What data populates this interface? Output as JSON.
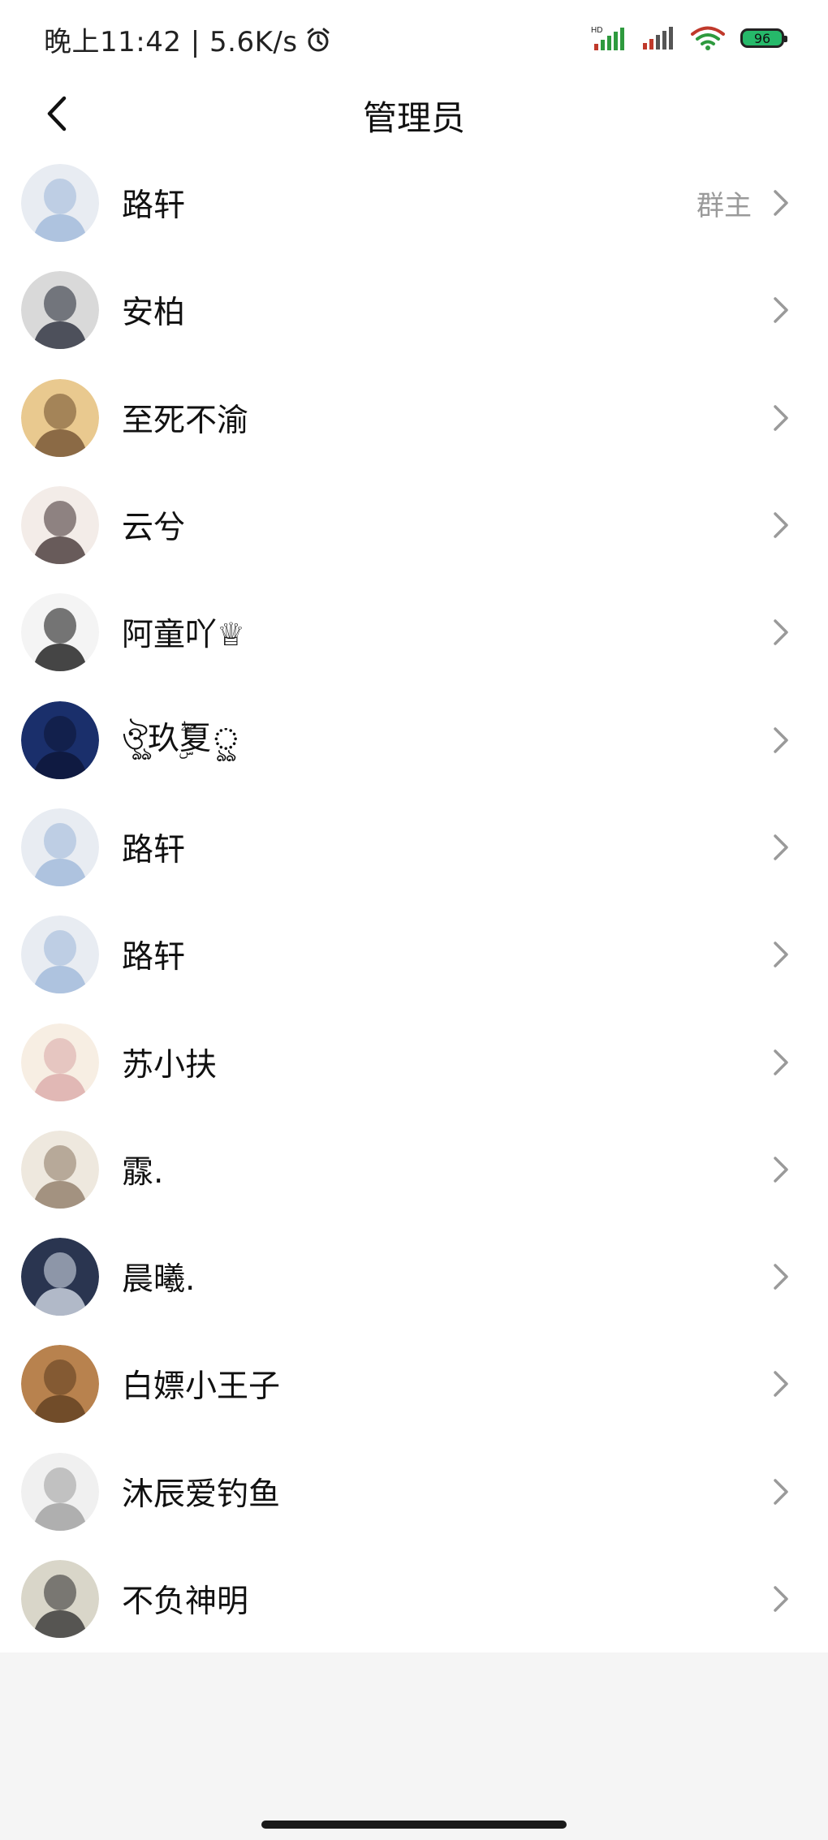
{
  "status_bar": {
    "time": "晚上11:42 | 5.6K/s",
    "alarm_icon": "alarm-clock-icon",
    "battery_level": "96"
  },
  "header": {
    "title": "管理员",
    "back_icon": "chevron-left-icon"
  },
  "members": [
    {
      "name": "路轩",
      "role": "群主",
      "avatar_color": "#e8ecf2",
      "avatar_accent": "#9bb6d8"
    },
    {
      "name": "安柏",
      "role": "",
      "avatar_color": "#d9d9d9",
      "avatar_accent": "#1e2230"
    },
    {
      "name": "至死不渝",
      "role": "",
      "avatar_color": "#e9c98f",
      "avatar_accent": "#6b4a2c"
    },
    {
      "name": "云兮",
      "role": "",
      "avatar_color": "#f3ece8",
      "avatar_accent": "#3a2b2b"
    },
    {
      "name": "阿童吖♕",
      "role": "",
      "avatar_color": "#f4f4f4",
      "avatar_accent": "#0b0b0b"
    },
    {
      "name": "ঔৣ玖ۣۖ夏ৣ",
      "role": "",
      "avatar_color": "#1a2f6b",
      "avatar_accent": "#0c1433"
    },
    {
      "name": "路轩",
      "role": "",
      "avatar_color": "#e8ecf2",
      "avatar_accent": "#9bb6d8"
    },
    {
      "name": "路轩",
      "role": "",
      "avatar_color": "#e8ecf2",
      "avatar_accent": "#9bb6d8"
    },
    {
      "name": "苏小扶",
      "role": "",
      "avatar_color": "#f7eee3",
      "avatar_accent": "#d9a6a6"
    },
    {
      "name": "霡.",
      "role": "",
      "avatar_color": "#eee8de",
      "avatar_accent": "#8a7560"
    },
    {
      "name": "晨曦.",
      "role": "",
      "avatar_color": "#2a3550",
      "avatar_accent": "#dfe6f0"
    },
    {
      "name": "白嫖小王子",
      "role": "",
      "avatar_color": "#b8824e",
      "avatar_accent": "#5a3a1e"
    },
    {
      "name": "沐辰爱钓鱼",
      "role": "",
      "avatar_color": "#f0f0f0",
      "avatar_accent": "#9a9a9a"
    },
    {
      "name": "不负神明",
      "role": "",
      "avatar_color": "#d9d6c9",
      "avatar_accent": "#2a2a2a"
    }
  ],
  "colors": {
    "background": "#f5f5f5",
    "list_background": "#ffffff",
    "role_text": "#9a9a9a",
    "chevron": "#9a9a9a"
  }
}
